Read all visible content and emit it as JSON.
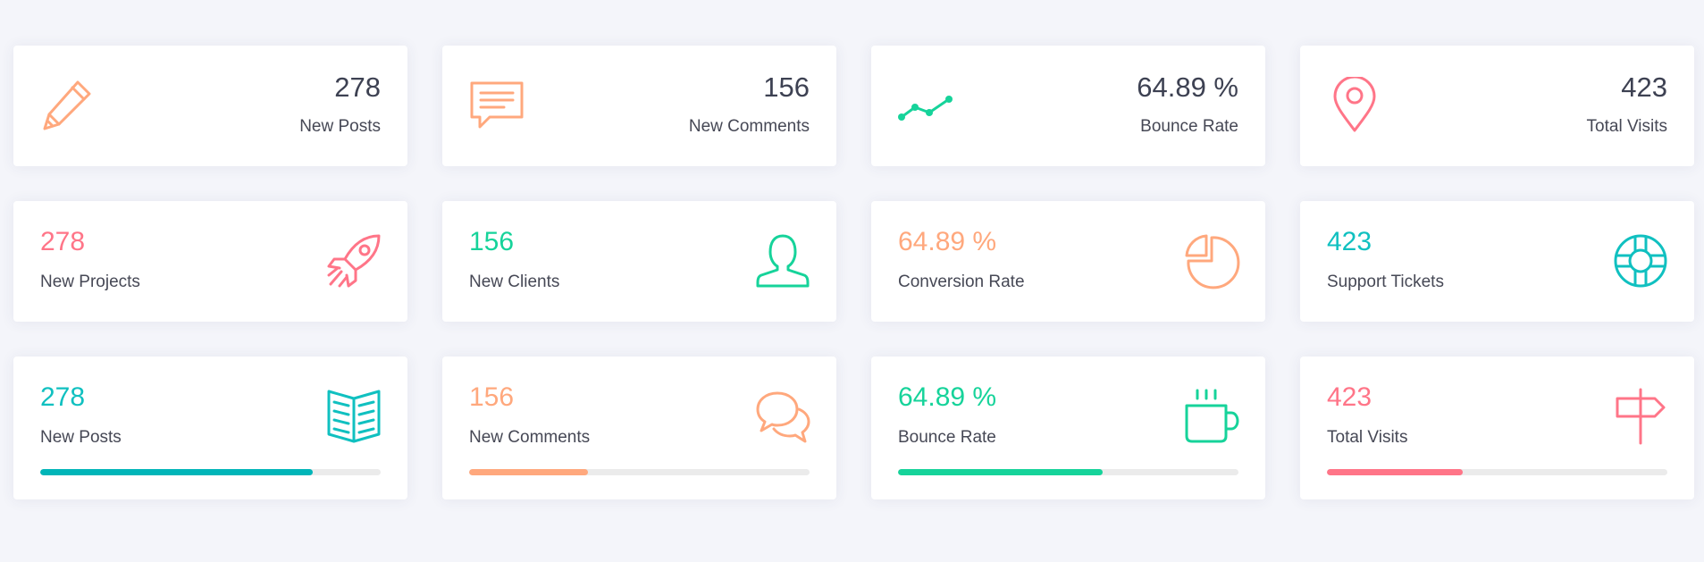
{
  "colors": {
    "red": "#ff7588",
    "green": "#16d39a",
    "orange": "#ffa87d",
    "teal": "#10c0c0",
    "teal_bar": "#00b5b8",
    "background": "#f4f5fa"
  },
  "row1": [
    {
      "value": "278",
      "label": "New Posts",
      "icon": "pencil-icon"
    },
    {
      "value": "156",
      "label": "New Comments",
      "icon": "speech-bubble-icon"
    },
    {
      "value": "64.89 %",
      "label": "Bounce Rate",
      "icon": "graph-icon"
    },
    {
      "value": "423",
      "label": "Total Visits",
      "icon": "map-pin-icon"
    }
  ],
  "row2": [
    {
      "value": "278",
      "label": "New Projects",
      "icon": "rocket-icon"
    },
    {
      "value": "156",
      "label": "New Clients",
      "icon": "user-icon"
    },
    {
      "value": "64.89 %",
      "label": "Conversion Rate",
      "icon": "pie-chart-icon"
    },
    {
      "value": "423",
      "label": "Support Tickets",
      "icon": "life-buoy-icon"
    }
  ],
  "row3": [
    {
      "value": "278",
      "label": "New Posts",
      "icon": "book-icon",
      "progress": 0.8
    },
    {
      "value": "156",
      "label": "New Comments",
      "icon": "chat-bubbles-icon",
      "progress": 0.35
    },
    {
      "value": "64.89 %",
      "label": "Bounce Rate",
      "icon": "cup-icon",
      "progress": 0.6
    },
    {
      "value": "423",
      "label": "Total Visits",
      "icon": "signpost-icon",
      "progress": 0.4
    }
  ]
}
